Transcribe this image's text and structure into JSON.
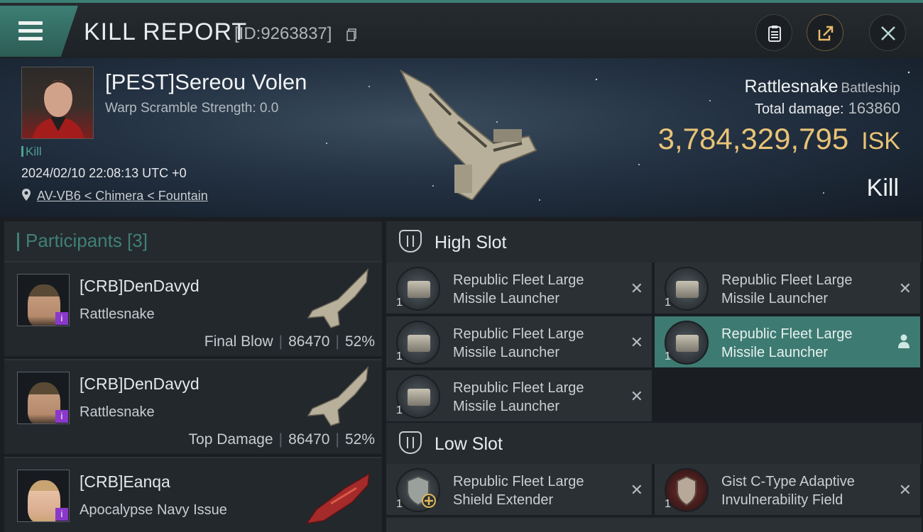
{
  "header": {
    "title": "KILL REPORT",
    "report_id": "[ID:9263837]"
  },
  "victim": {
    "name": "[PEST]Sereou Volen",
    "warp_scramble": "Warp Scramble Strength: 0.0",
    "tag": "Kill",
    "datetime": "2024/02/10 22:08:13 UTC +0",
    "location": "AV-VB6 < Chimera < Fountain"
  },
  "ship": {
    "name": "Rattlesnake",
    "class": "Battleship",
    "total_damage_label": "Total damage:",
    "total_damage": "163860",
    "isk_value": "3,784,329,795",
    "isk_unit": "ISK",
    "result": "Kill"
  },
  "participants": {
    "label": "Participants",
    "count": "[3]",
    "rows": [
      {
        "name": "[CRB]DenDavyd",
        "ship": "Rattlesnake",
        "role": "Final Blow",
        "damage": "86470",
        "percent": "52%"
      },
      {
        "name": "[CRB]DenDavyd",
        "ship": "Rattlesnake",
        "role": "Top Damage",
        "damage": "86470",
        "percent": "52%"
      },
      {
        "name": "[CRB]Eanqa",
        "ship": "Apocalypse Navy Issue"
      }
    ]
  },
  "fitting": {
    "high_slot_label": "High Slot",
    "low_slot_label": "Low Slot",
    "high": [
      {
        "name": "Republic Fleet Large Missile Launcher",
        "qty": "1"
      },
      {
        "name": "Republic Fleet Large Missile Launcher",
        "qty": "1"
      },
      {
        "name": "Republic Fleet Large Missile Launcher",
        "qty": "1"
      },
      {
        "name": "Republic Fleet Large Missile Launcher",
        "qty": "1"
      },
      {
        "name": "Republic Fleet Large Missile Launcher",
        "qty": "1"
      }
    ],
    "low": [
      {
        "name": "Republic Fleet Large Shield Extender",
        "qty": "1"
      },
      {
        "name": "Gist C-Type Adaptive Invulnerability Field",
        "qty": "1"
      }
    ]
  },
  "icons": {
    "menu": "hamburger-menu-icon",
    "copy": "copy-icon",
    "clipboard": "clipboard-icon",
    "share": "share-icon",
    "close": "close-icon",
    "location": "location-pin-icon",
    "remove": "x-icon",
    "owner": "person-icon"
  },
  "colors": {
    "accent": "#3d7f74",
    "isk": "#e8c377",
    "active_row": "#3d7a72"
  }
}
